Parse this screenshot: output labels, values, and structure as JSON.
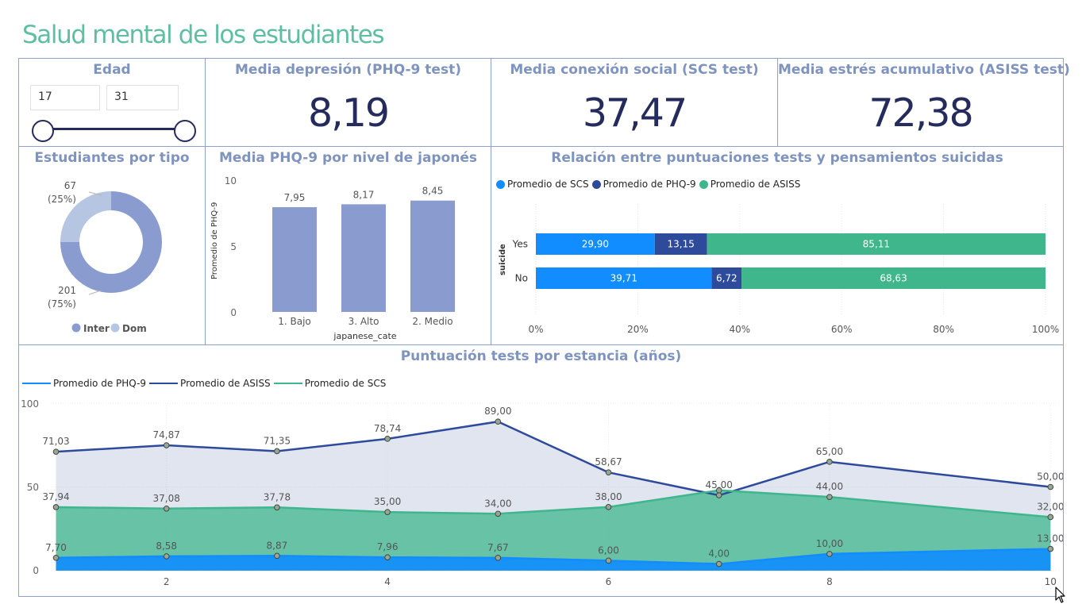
{
  "title": "Salud mental de los estudiantes",
  "age_filter": {
    "title": "Edad",
    "min": "17",
    "max": "31"
  },
  "kpis": [
    {
      "title": "Media depresión (PHQ-9 test)",
      "value": "8,19"
    },
    {
      "title": "Media conexión social (SCS test)",
      "value": "37,47"
    },
    {
      "title": "Media estrés acumulativo (ASISS test)",
      "value": "72,38"
    }
  ],
  "donut": {
    "title": "Estudiantes por tipo",
    "label_dom_count": "67",
    "label_dom_pct": "(25%)",
    "label_inter_count": "201",
    "label_inter_pct": "(75%)",
    "legend": [
      {
        "label": "Inter",
        "color": "#8a9ccf"
      },
      {
        "label": "Dom",
        "color": "#b5c5e2"
      }
    ]
  },
  "bar_chart": {
    "title": "Media PHQ-9 por nivel de japonés",
    "ylabel": "Promedio de PHQ-9",
    "xlabel": "japanese_cate",
    "yticks": [
      "10",
      "5",
      "0"
    ]
  },
  "stacked_chart": {
    "title": "Relación entre puntuaciones tests y pensamientos suicidas",
    "ylabel": "suicide",
    "xticks": [
      "0%",
      "20%",
      "40%",
      "60%",
      "80%",
      "100%"
    ],
    "legend": [
      {
        "label": "Promedio de SCS",
        "color": "#118dff"
      },
      {
        "label": "Promedio de PHQ-9",
        "color": "#2e4a9b"
      },
      {
        "label": "Promedio de ASISS",
        "color": "#3fb68c"
      }
    ]
  },
  "line_chart": {
    "title": "Puntuación tests por estancia (años)",
    "legend": [
      {
        "label": "Promedio de PHQ-9",
        "color": "#118dff"
      },
      {
        "label": "Promedio de ASISS",
        "color": "#2e4a9b"
      },
      {
        "label": "Promedio de SCS",
        "color": "#3fb68c"
      }
    ],
    "yticks": [
      "100",
      "50",
      "0"
    ],
    "xticks": [
      "2",
      "4",
      "6",
      "8",
      "10"
    ]
  },
  "chart_data": [
    {
      "type": "pie",
      "title": "Estudiantes por tipo",
      "categories": [
        "Inter",
        "Dom"
      ],
      "values": [
        201,
        67
      ]
    },
    {
      "type": "bar",
      "title": "Media PHQ-9 por nivel de japonés",
      "categories": [
        "1. Bajo",
        "3. Alto",
        "2. Medio"
      ],
      "values": [
        7.95,
        8.17,
        8.45
      ],
      "value_labels": [
        "7,95",
        "8,17",
        "8,45"
      ],
      "xlabel": "japanese_cate",
      "ylabel": "Promedio de PHQ-9",
      "ylim": [
        0,
        10
      ]
    },
    {
      "type": "bar",
      "title": "Relación entre puntuaciones tests y pensamientos suicidas",
      "categories": [
        "Yes",
        "No"
      ],
      "series": [
        {
          "name": "Promedio de SCS",
          "values": [
            29.9,
            39.71
          ],
          "labels": [
            "29,90",
            "39,71"
          ]
        },
        {
          "name": "Promedio de PHQ-9",
          "values": [
            13.15,
            6.72
          ],
          "labels": [
            "13,15",
            "6,72"
          ]
        },
        {
          "name": "Promedio de ASISS",
          "values": [
            85.11,
            68.63
          ],
          "labels": [
            "85,11",
            "68,63"
          ]
        }
      ],
      "ylabel": "suicide",
      "xlim": [
        0,
        1
      ],
      "stacked": "100%",
      "legend": "top-left"
    },
    {
      "type": "area",
      "title": "Puntuación tests por estancia (años)",
      "x": [
        1,
        2,
        3,
        4,
        5,
        6,
        7,
        8,
        10
      ],
      "series": [
        {
          "name": "Promedio de PHQ-9",
          "values": [
            7.7,
            8.58,
            8.87,
            7.96,
            7.67,
            6.0,
            4.0,
            10.0,
            13.0
          ],
          "labels": [
            "7,70",
            "8,58",
            "8,87",
            "7,96",
            "7,67",
            "6,00",
            "4,00",
            "10,00",
            "13,00"
          ]
        },
        {
          "name": "Promedio de ASISS",
          "values": [
            71.03,
            74.87,
            71.35,
            78.74,
            89.0,
            58.67,
            45.0,
            65.0,
            50.0
          ],
          "labels": [
            "71,03",
            "74,87",
            "71,35",
            "78,74",
            "89,00",
            "58,67",
            "45,00",
            "65,00",
            "50,00"
          ]
        },
        {
          "name": "Promedio de SCS",
          "values": [
            37.94,
            37.08,
            37.78,
            35.0,
            34.0,
            38.0,
            48.0,
            44.0,
            32.0
          ],
          "labels": [
            "37,94",
            "37,08",
            "37,78",
            "35,00",
            "34,00",
            "38,00",
            "",
            "44,00",
            "32,00"
          ]
        }
      ],
      "ylim": [
        0,
        100
      ],
      "legend": "top-left"
    }
  ]
}
